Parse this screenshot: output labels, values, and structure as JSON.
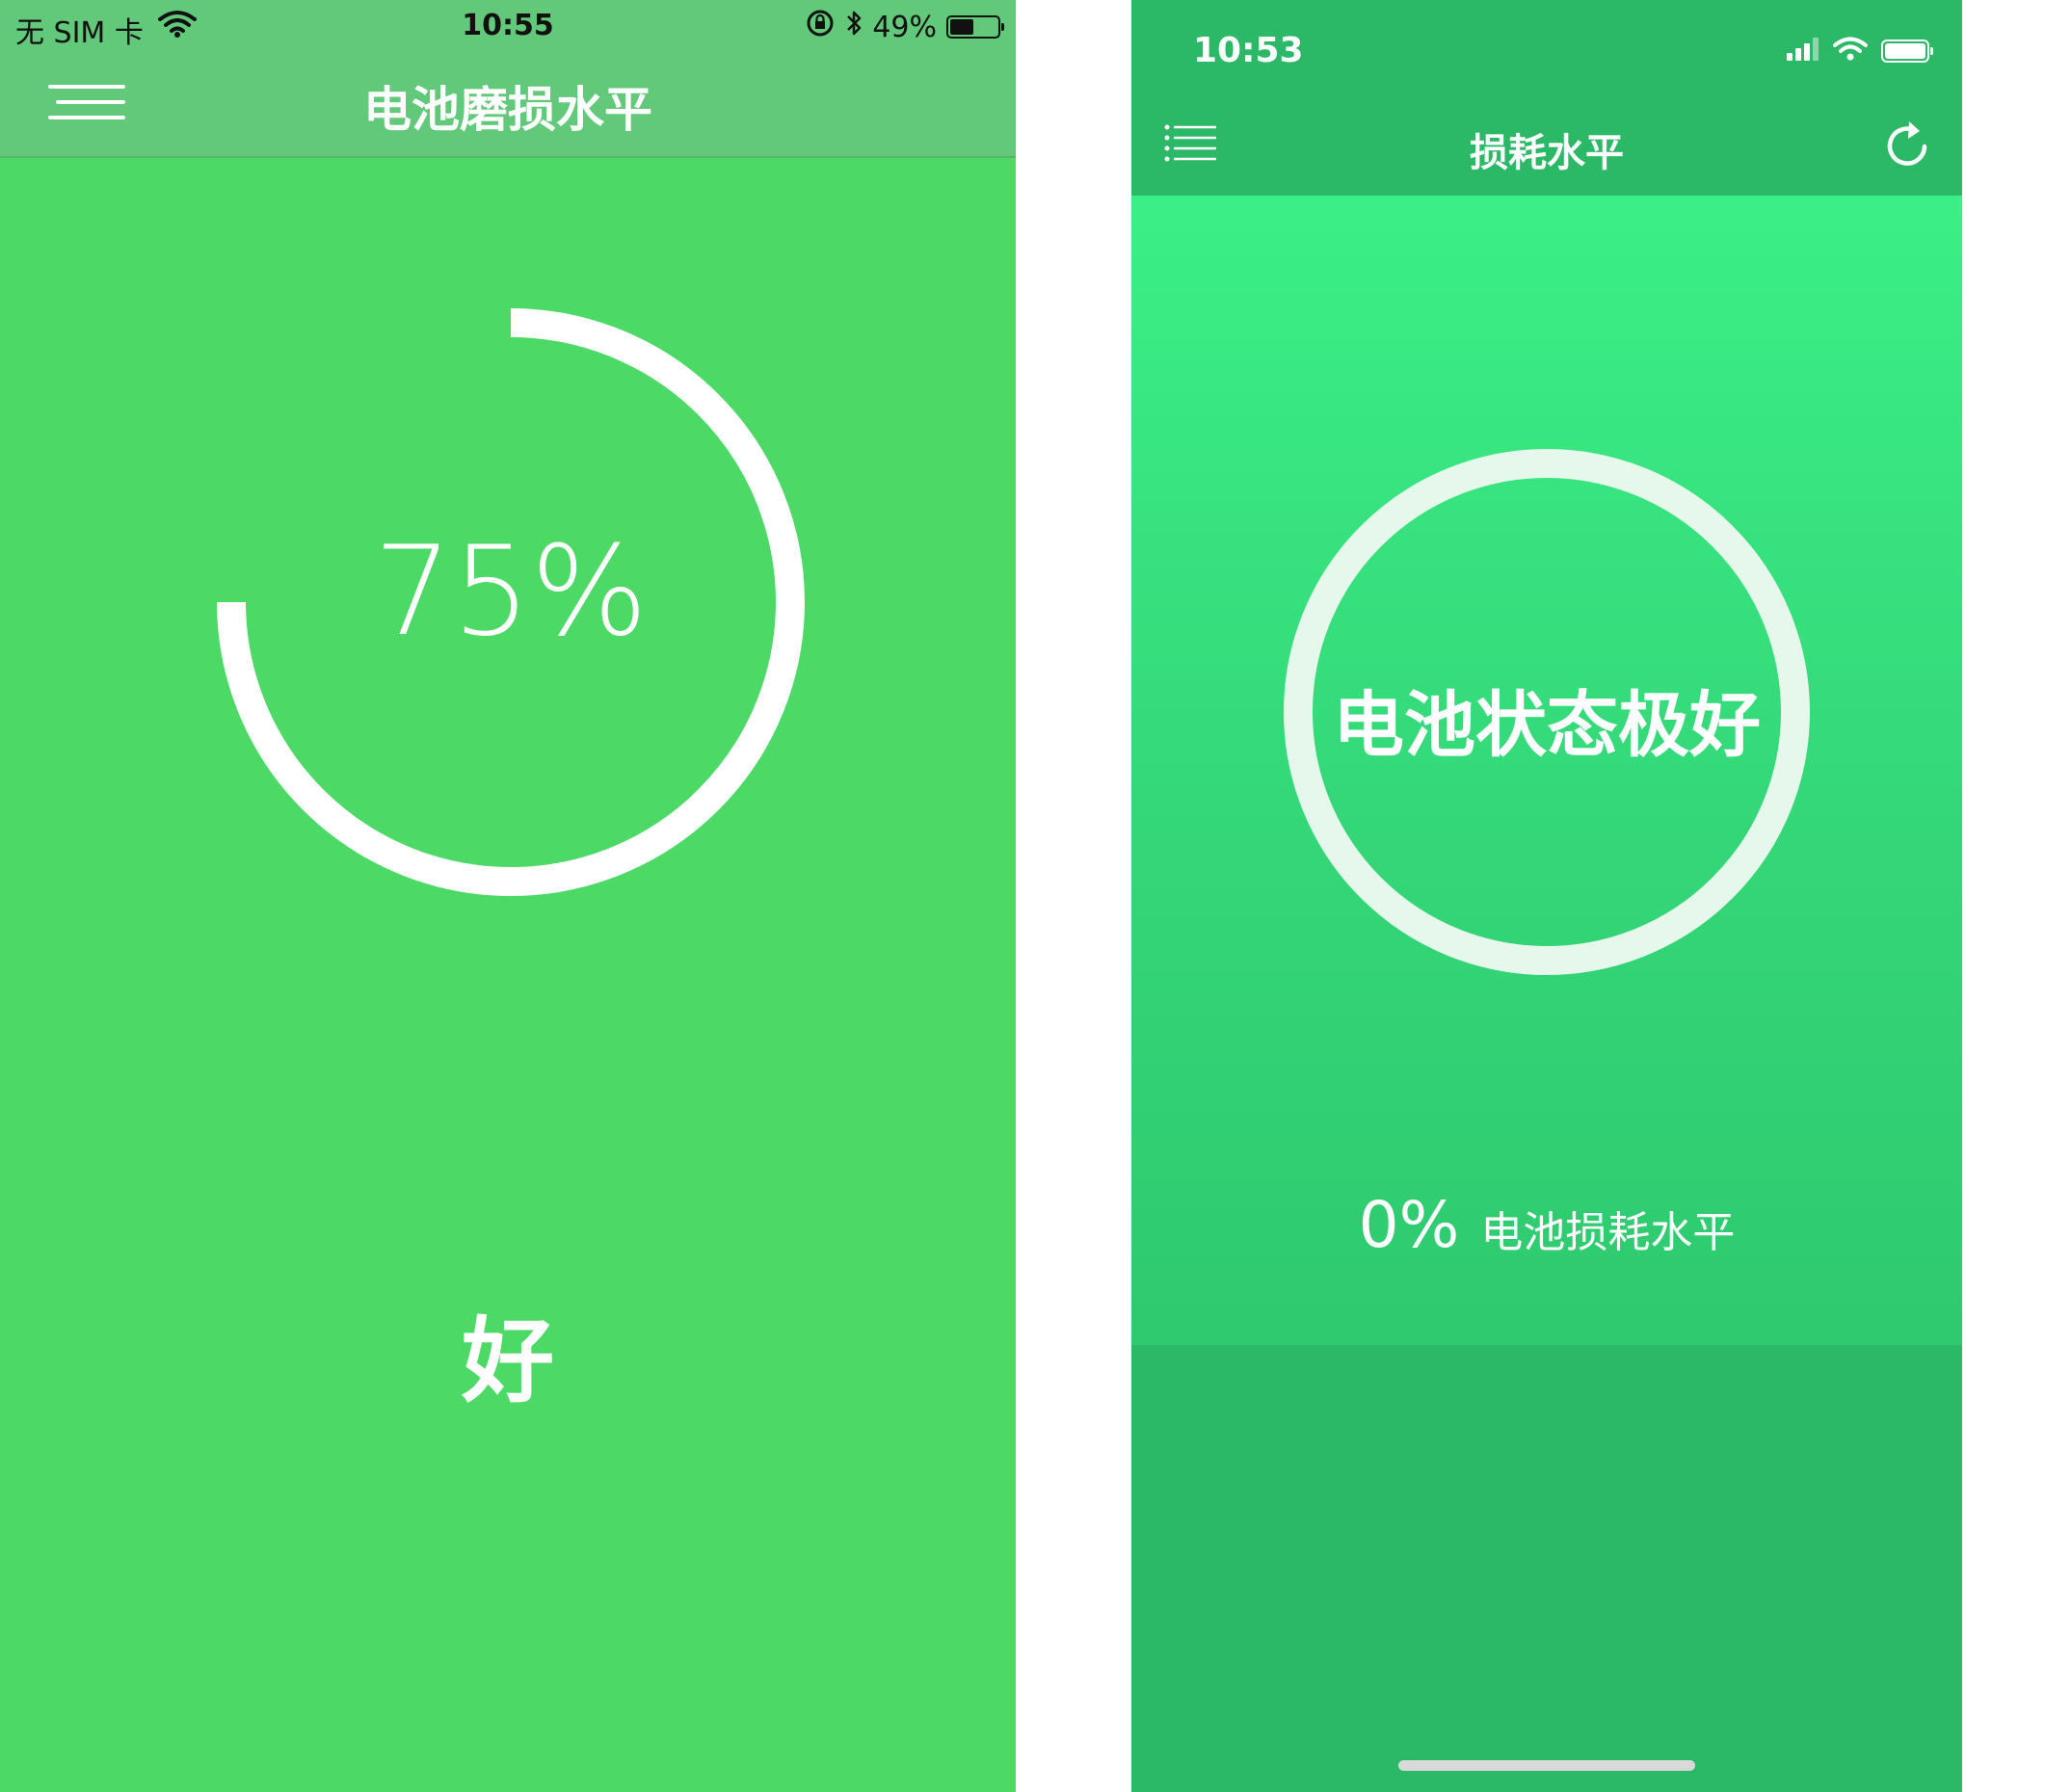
{
  "left": {
    "status_bar": {
      "carrier": "无 SIM 卡",
      "time": "10:55",
      "battery_percent": "49%",
      "battery_level": 0.49
    },
    "nav": {
      "title": "电池磨损水平"
    },
    "gauge": {
      "percent_label": "75%",
      "progress": 0.75,
      "color": "#ffffff"
    },
    "rating": "好",
    "colors": {
      "background": "#4cd966",
      "bar": "#63c97a"
    }
  },
  "right": {
    "status_bar": {
      "time": "10:53"
    },
    "nav": {
      "title": "损耗水平"
    },
    "status_text": "电池状态极好",
    "wear": {
      "value": "0%",
      "label": "电池损耗水平"
    },
    "colors": {
      "header": "#2cb967",
      "gradient_top": "#3bef86",
      "ring": "#e6f8ec"
    }
  },
  "icons": {
    "menu": "hamburger-menu-icon",
    "list": "list-icon",
    "refresh": "refresh-icon",
    "wifi": "wifi-icon",
    "bluetooth": "bluetooth-icon",
    "lock": "orientation-lock-icon",
    "signal": "signal-icon",
    "battery": "battery-icon"
  }
}
